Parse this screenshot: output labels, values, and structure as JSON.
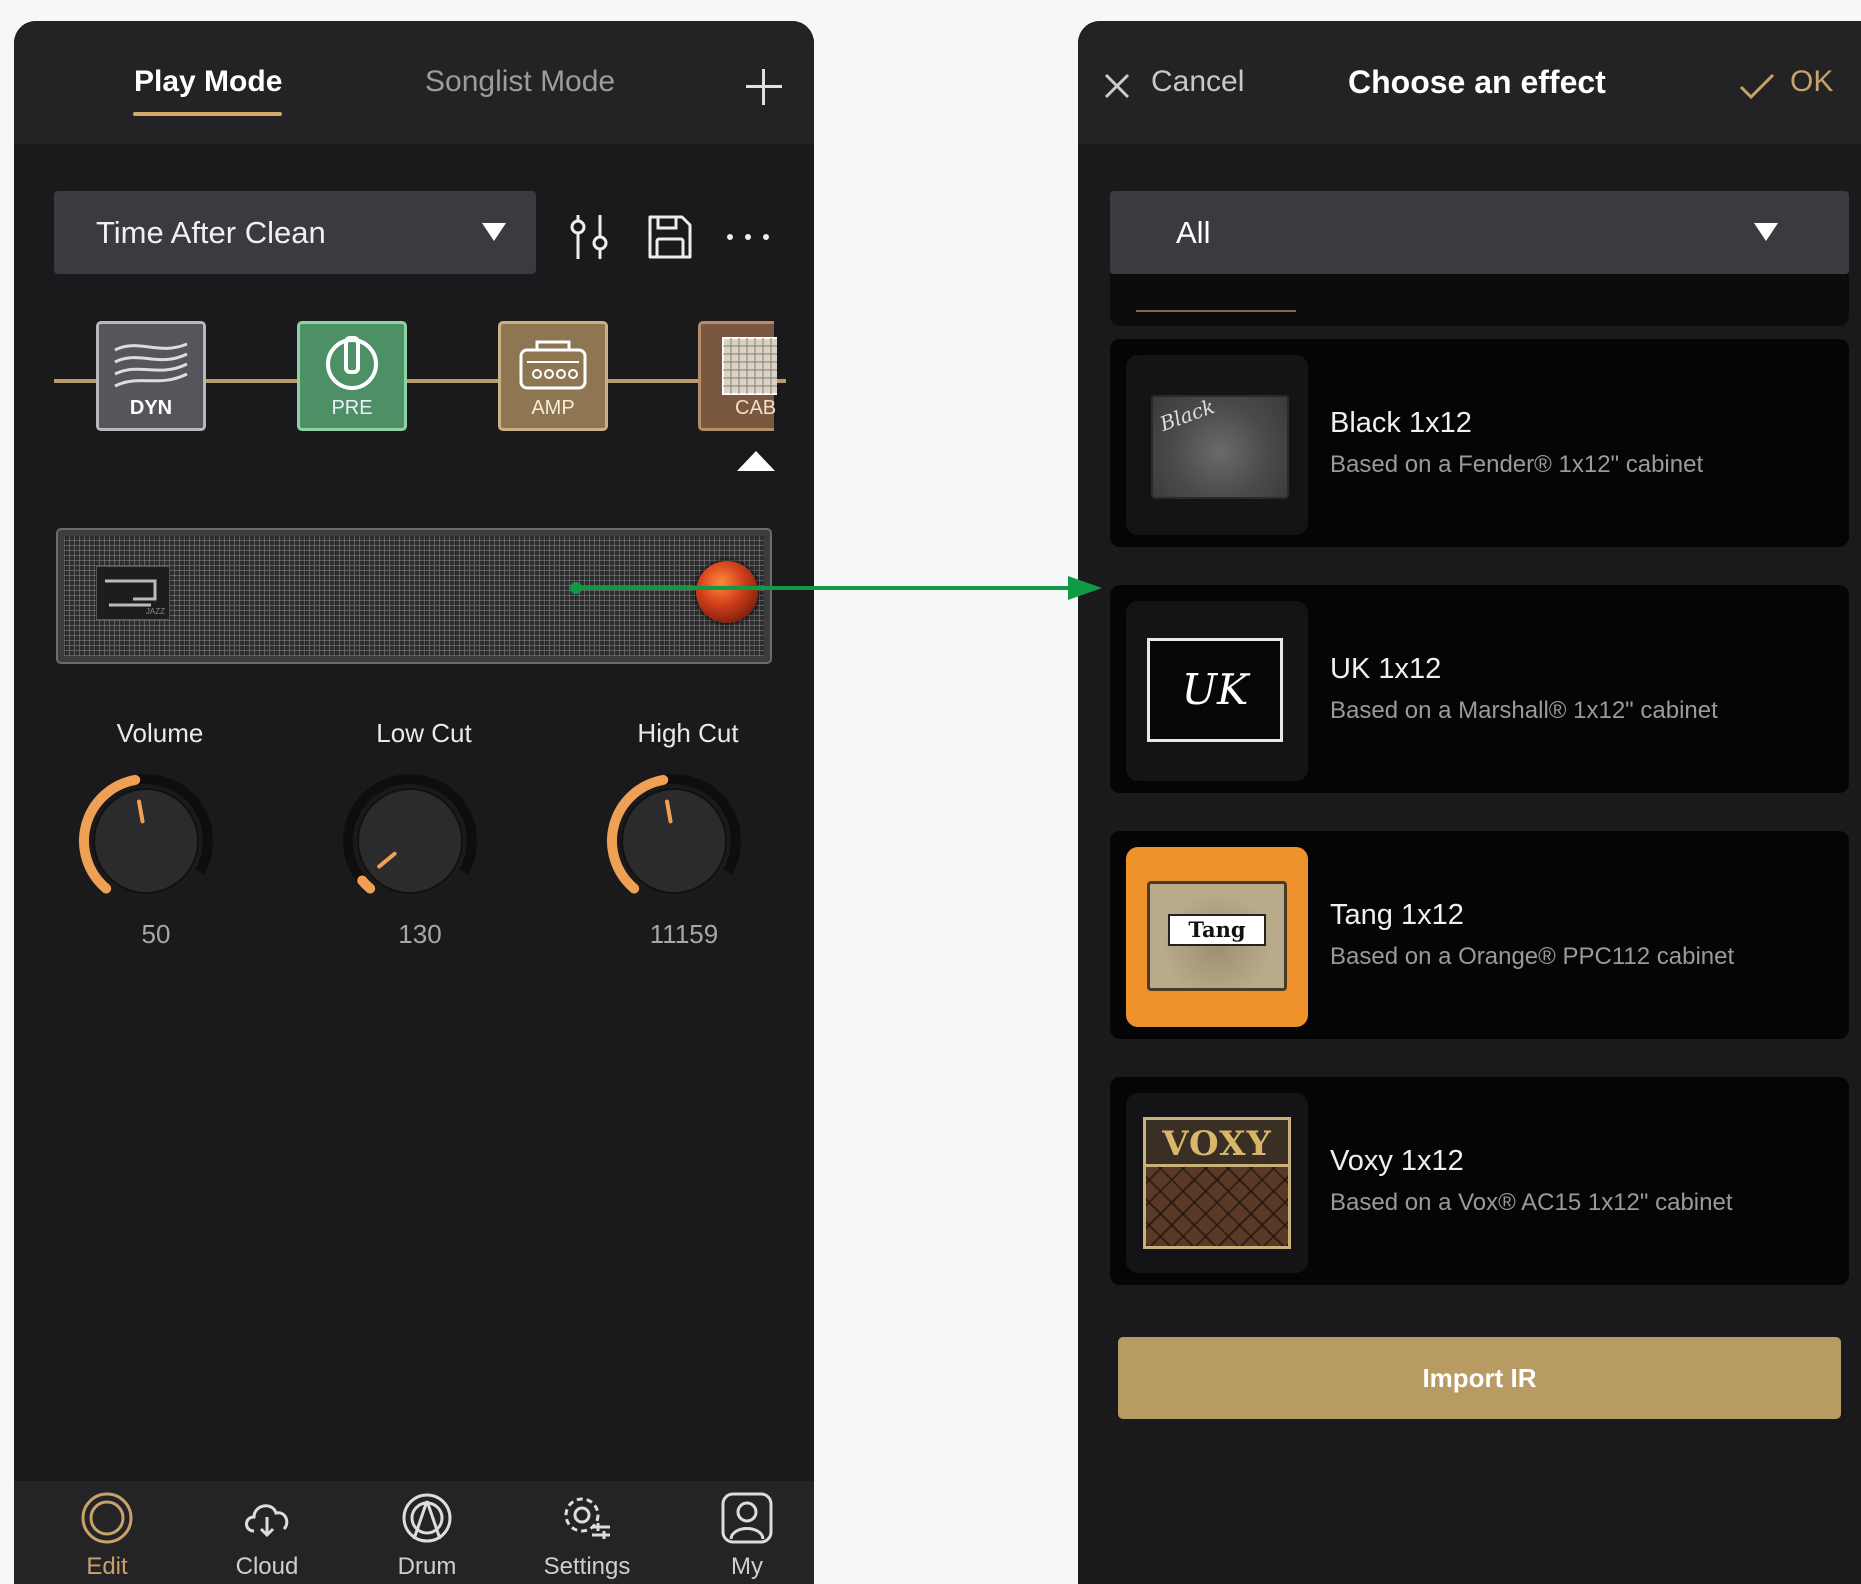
{
  "left": {
    "tabs": {
      "play_mode": "Play Mode",
      "songlist_mode": "Songlist Mode"
    },
    "preset": {
      "name": "Time After Clean"
    },
    "chain": [
      "DYN",
      "PRE",
      "AMP",
      "CAB"
    ],
    "grille_logo": "JAZZ",
    "knobs": [
      {
        "label": "Volume",
        "value": "50",
        "level": 0.5
      },
      {
        "label": "Low Cut",
        "value": "130",
        "level": 0.04
      },
      {
        "label": "High Cut",
        "value": "11159",
        "level": 0.5
      }
    ],
    "nav": [
      "Edit",
      "Cloud",
      "Drum",
      "Settings",
      "My"
    ]
  },
  "right": {
    "header": {
      "cancel": "Cancel",
      "title": "Choose an effect",
      "ok": "OK"
    },
    "filter": "All",
    "items": [
      {
        "name": "Black 1x12",
        "desc": "Based on a Fender® 1x12\" cabinet",
        "badge": "Black"
      },
      {
        "name": "UK 1x12",
        "desc": "Based on a Marshall® 1x12\" cabinet",
        "badge": "UK"
      },
      {
        "name": "Tang 1x12",
        "desc": "Based on a Orange® PPC112 cabinet",
        "badge": "Tang"
      },
      {
        "name": "Voxy 1x12",
        "desc": "Based on a Vox®  AC15 1x12\" cabinet",
        "badge": "VOXY"
      }
    ],
    "import": "Import IR"
  },
  "colors": {
    "accent": "#d4aa69",
    "knob_arc": "#f0a055",
    "arrow": "#119a45"
  }
}
